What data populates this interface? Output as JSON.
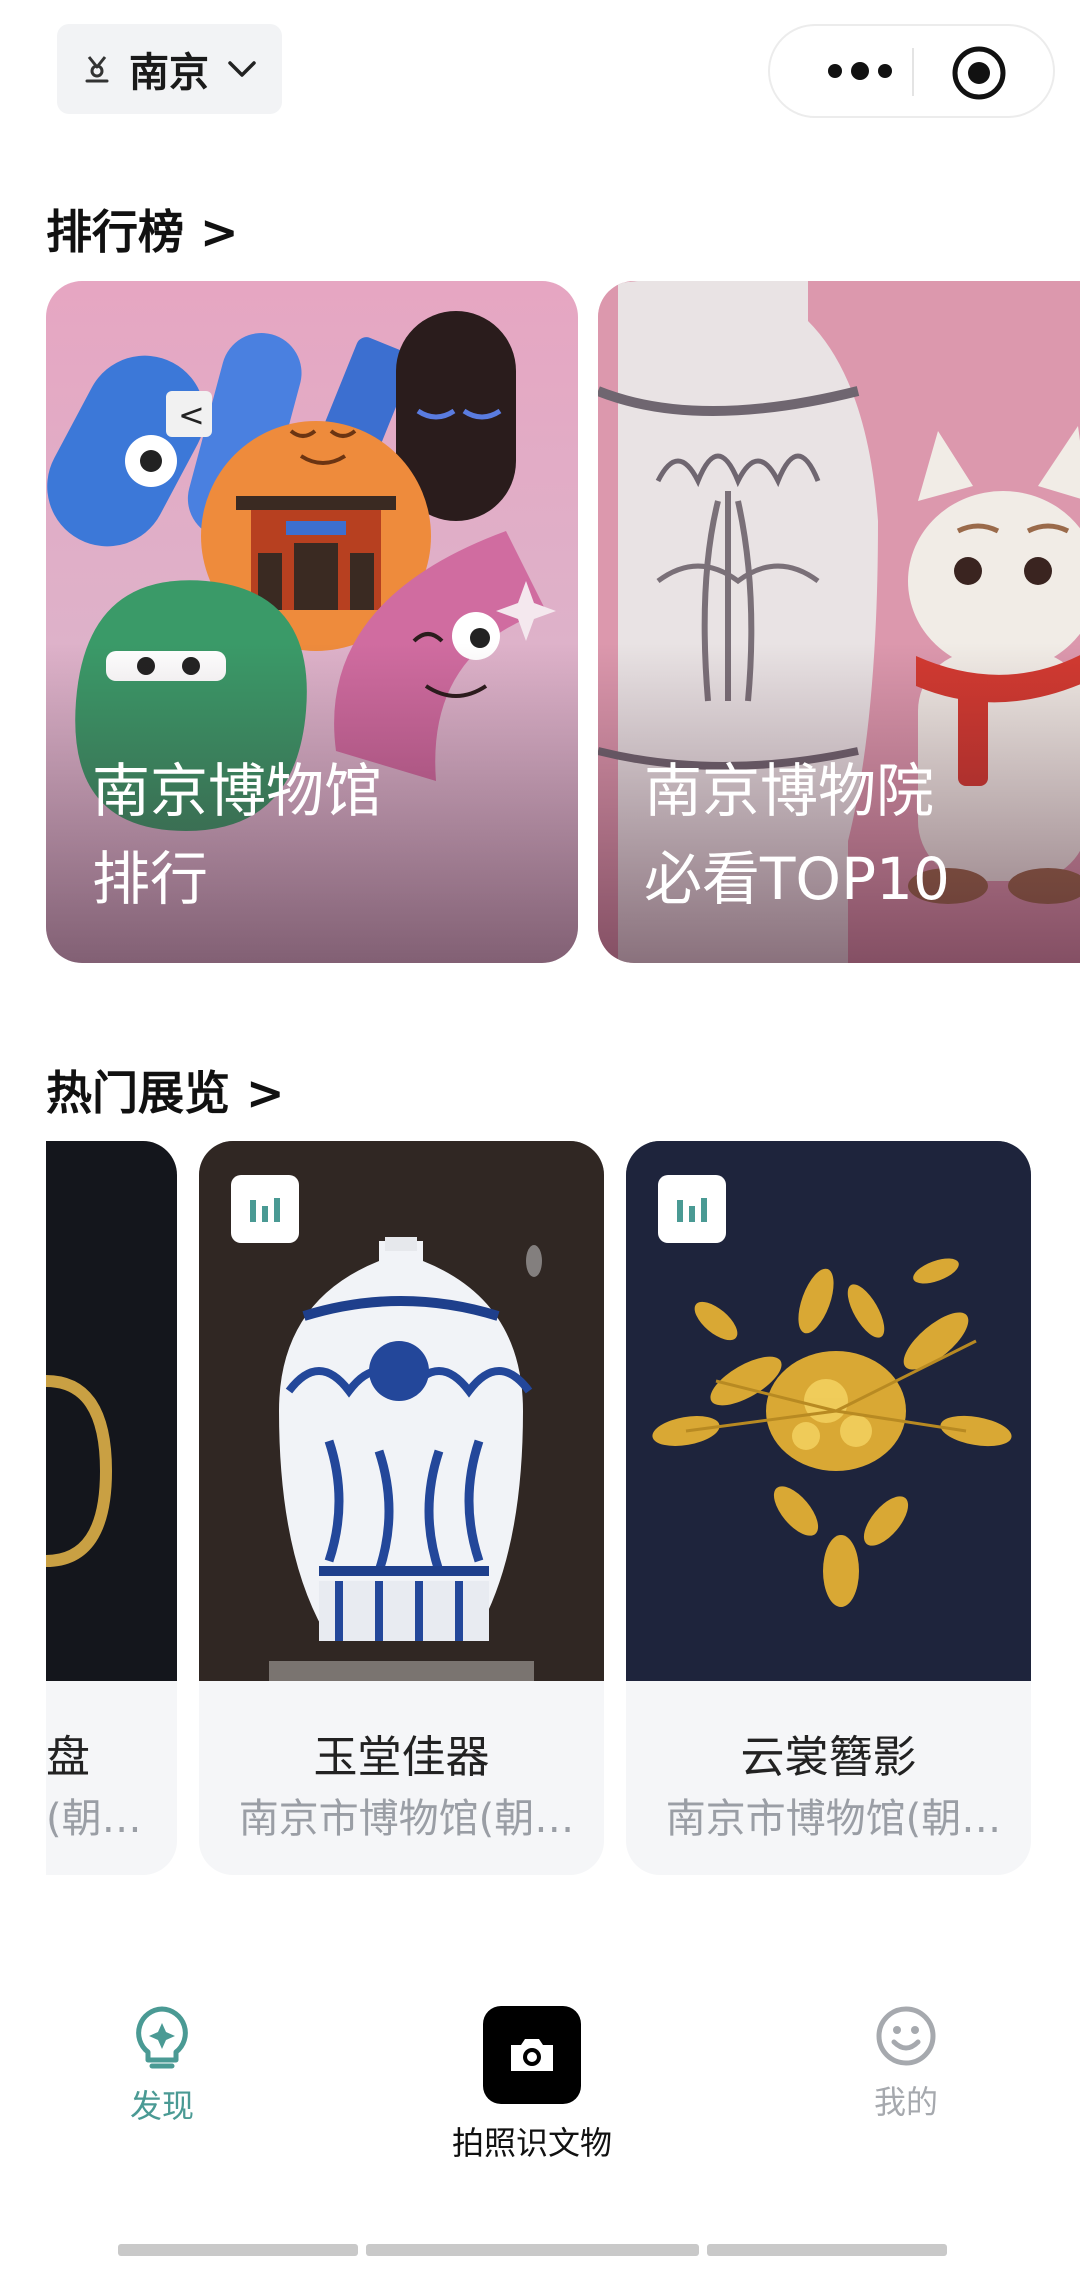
{
  "header": {
    "city": "南京",
    "pin_icon": "location-pin-icon",
    "chevron_icon": "chevron-down-icon",
    "more_icon": "more-dots-icon",
    "target_icon": "record-target-icon"
  },
  "ranking": {
    "title": "排行榜 >",
    "cards": [
      {
        "line1": "南京博物馆",
        "line2": "排行"
      },
      {
        "line1": "南京博物院",
        "line2": "必看TOP10"
      }
    ]
  },
  "exhibitions": {
    "title": "热门展览 >",
    "cards": [
      {
        "name": "盘",
        "venue": "(朝…"
      },
      {
        "name": "玉堂佳器",
        "venue": "南京市博物馆(朝…"
      },
      {
        "name": "云裳簪影",
        "venue": "南京市博物馆(朝…"
      }
    ],
    "badge_icon": "bar-chart-icon"
  },
  "tabbar": {
    "discover": "发现",
    "camera": "拍照识文物",
    "mine": "我的"
  },
  "colors": {
    "accent": "#4a9a94",
    "inactive": "#a6a9ae",
    "card_bg": "#f5f6f8"
  }
}
